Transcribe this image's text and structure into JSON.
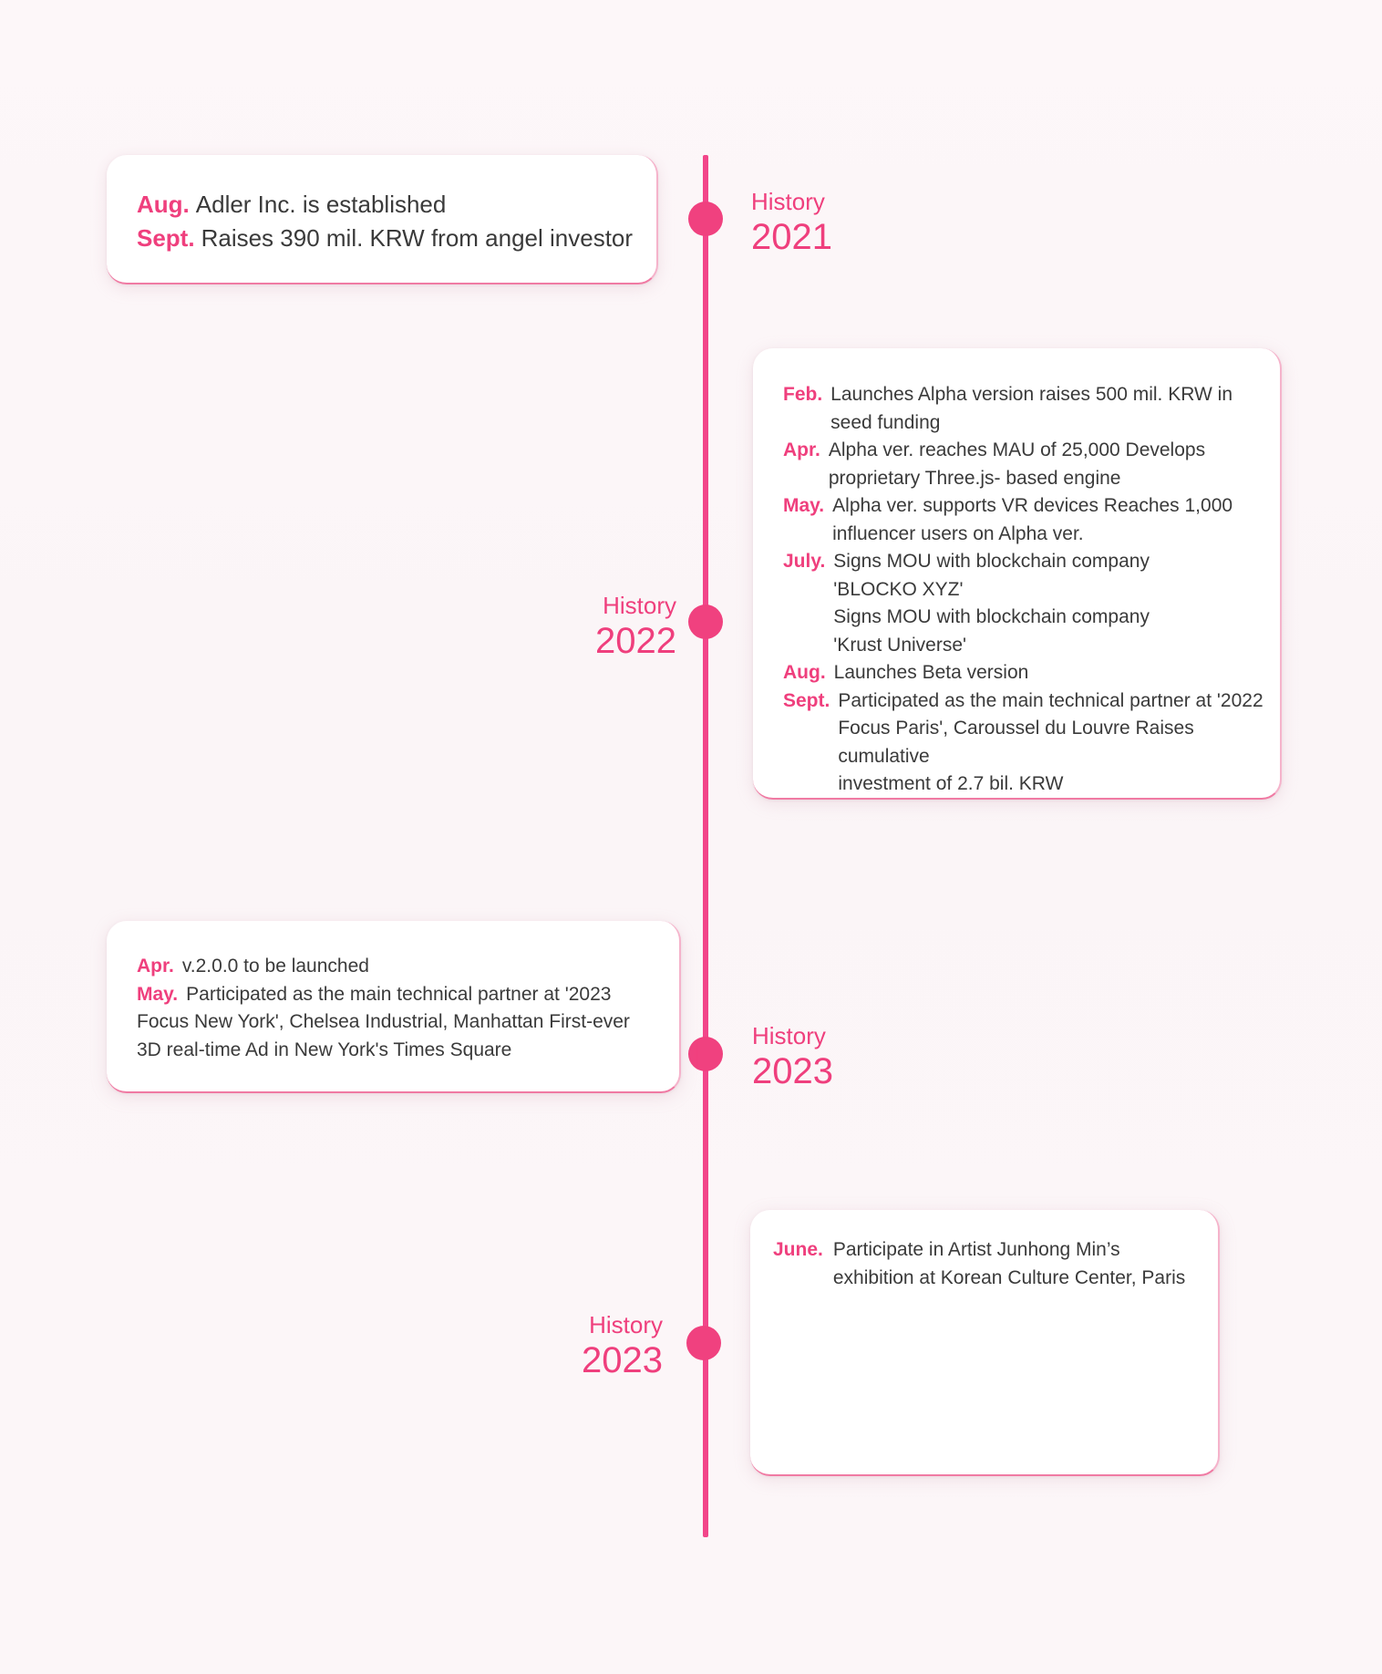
{
  "colors": {
    "accent": "#f0417f",
    "text": "#3a3a3a",
    "card": "#ffffff",
    "background": "#fcf6f8"
  },
  "sections": [
    {
      "history_word": "History",
      "year": "2021",
      "entries": [
        {
          "month": "Aug.",
          "text": "Adler Inc. is established"
        },
        {
          "month": "Sept.",
          "text": "Raises 390 mil. KRW from angel investor"
        }
      ]
    },
    {
      "history_word": "History",
      "year": "2022",
      "entries": [
        {
          "month": "Feb.",
          "text": "Launches Alpha version raises 500 mil. KRW in\nseed funding"
        },
        {
          "month": "Apr.",
          "text": "Alpha ver. reaches MAU of 25,000 Develops\nproprietary Three.js- based engine"
        },
        {
          "month": "May.",
          "text": "Alpha ver. supports VR devices Reaches 1,000\ninfluencer users on Alpha ver."
        },
        {
          "month": "July.",
          "text": "Signs MOU with blockchain company\n'BLOCKO XYZ'\nSigns MOU with blockchain company\n'Krust Universe'"
        },
        {
          "month": "Aug.",
          "text": "Launches Beta version"
        },
        {
          "month": "Sept.",
          "text": "Participated as the main technical partner at '2022\nFocus Paris', Caroussel du Louvre Raises cumulative\ninvestment of 2.7 bil. KRW"
        }
      ]
    },
    {
      "history_word": "History",
      "year": "2023",
      "entries": [
        {
          "month": "Apr.",
          "text": "v.2.0.0 to be launched"
        },
        {
          "month": "May.",
          "text": "Participated as the main technical partner at '2023"
        },
        {
          "month": "",
          "text": "Focus New York', Chelsea Industrial, Manhattan First-ever\n3D real-time Ad in New York's Times Square"
        }
      ]
    },
    {
      "history_word": "History",
      "year": "2023",
      "entries": [
        {
          "month": "June.",
          "text": "Participate in Artist Junhong Min’s\nexhibition at Korean Culture Center, Paris"
        }
      ]
    }
  ]
}
